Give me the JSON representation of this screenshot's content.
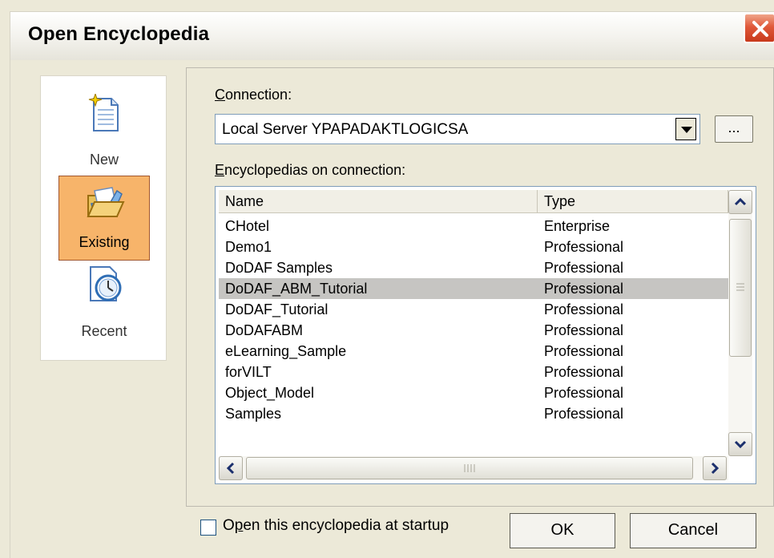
{
  "window": {
    "title": "Open Encyclopedia",
    "close_label": "Close"
  },
  "modes": [
    {
      "label": "New",
      "icon": "new-document-icon",
      "selected": false
    },
    {
      "label": "Existing",
      "icon": "open-folder-icon",
      "selected": true
    },
    {
      "label": "Recent",
      "icon": "recent-clock-icon",
      "selected": false
    }
  ],
  "connection": {
    "label": "Connection:",
    "mnemonic": "C",
    "value": "Local Server YPAPADAKTLOGICSA",
    "browse_label": "..."
  },
  "encyclopedias": {
    "label": "Encyclopedias on connection:",
    "mnemonic": "E",
    "columns": [
      "Name",
      "Type"
    ],
    "rows": [
      {
        "name": "CHotel",
        "type": "Enterprise"
      },
      {
        "name": "Demo1",
        "type": "Professional"
      },
      {
        "name": "DoDAF Samples",
        "type": "Professional"
      },
      {
        "name": "DoDAF_ABM_Tutorial",
        "type": "Professional",
        "selected": true
      },
      {
        "name": "DoDAF_Tutorial",
        "type": "Professional"
      },
      {
        "name": "DoDAFABM",
        "type": "Professional"
      },
      {
        "name": "eLearning_Sample",
        "type": "Professional"
      },
      {
        "name": "forVILT",
        "type": "Professional"
      },
      {
        "name": "Object_Model",
        "type": "Professional"
      },
      {
        "name": "Samples",
        "type": "Professional"
      }
    ]
  },
  "startup": {
    "label": "Open this encyclopedia at startup",
    "checked": false
  },
  "buttons": {
    "ok": "OK",
    "cancel": "Cancel"
  },
  "colors": {
    "selected_mode_bg": "#f7b46a",
    "selected_row_bg": "#c6c5c2",
    "close_button": "#e0593a"
  }
}
